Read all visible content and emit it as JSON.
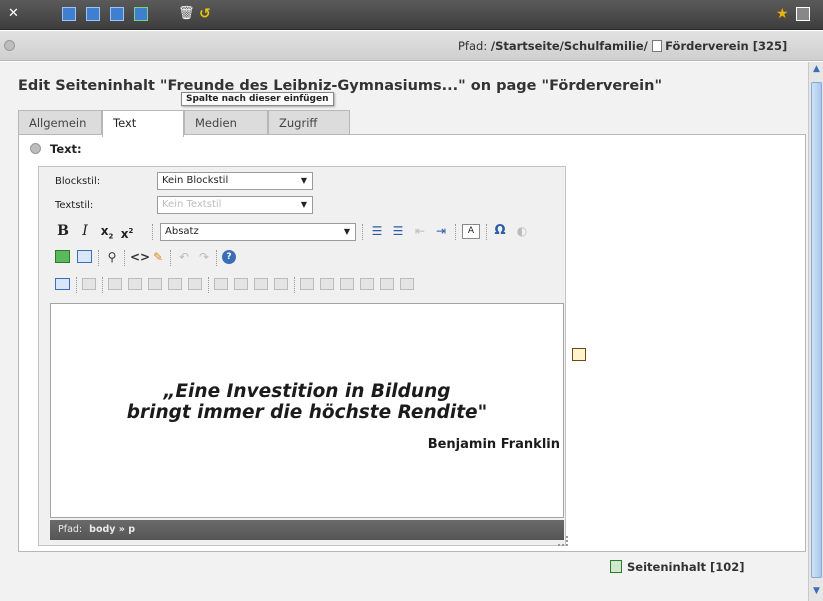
{
  "topbar": {
    "icons": [
      "close-icon",
      "save-icon",
      "save-view-icon",
      "save-close-icon",
      "save-new-icon",
      "delete-icon",
      "undo-icon",
      "favorite-icon",
      "fullscreen-icon"
    ]
  },
  "path": {
    "label": "Pfad:",
    "value": "/Startseite/Schulfamilie/",
    "page": "Förderverein [325]"
  },
  "heading": "Edit Seiteninhalt \"Freunde des Leibniz-Gymnasiums...\" on page \"Förderverein\"",
  "tooltip": "Spalte nach dieser einfügen",
  "tabs": [
    "Allgemein",
    "Text",
    "Medien",
    "Zugriff"
  ],
  "active_tab": "Text",
  "section_label": "Text:",
  "rte": {
    "blockstil_label": "Blockstil:",
    "blockstil_value": "Kein Blockstil",
    "textstil_label": "Textstil:",
    "textstil_value": "Kein Textstil",
    "paragraph_value": "Absatz",
    "special_char": "Ω",
    "status_label": "Pfad:",
    "status_path": "body » p"
  },
  "editor": {
    "quote_line1": "„Eine Investition in Bildung",
    "quote_line2": "bringt immer die höchste Rendite\"",
    "author": "Benjamin Franklin"
  },
  "footer": {
    "link": "Seiteninhalt [102]"
  },
  "colors": {
    "topbar": "#4a4a4a",
    "accent_blue": "#3a6fb8",
    "favorite_yellow": "#e8b400"
  }
}
